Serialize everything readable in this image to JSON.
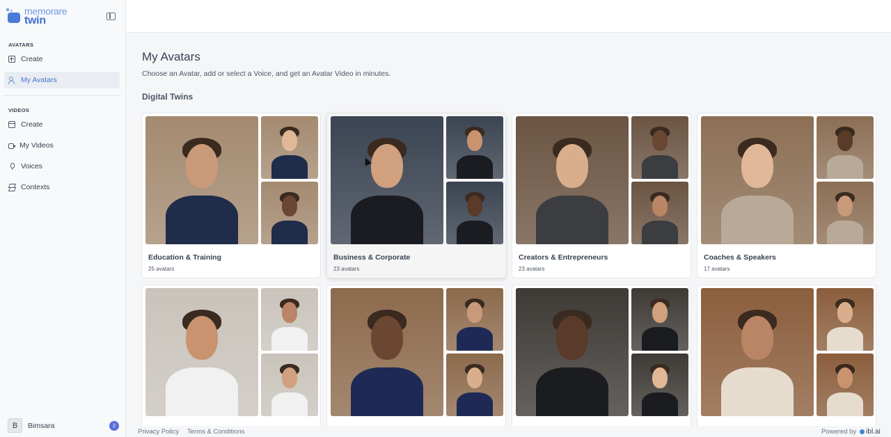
{
  "app": {
    "logo_line1": "memorare",
    "logo_line2": "twin"
  },
  "sidebar": {
    "avatars_section": "AVATARS",
    "avatars_items": [
      {
        "label": "Create",
        "icon": "plus-square-icon"
      },
      {
        "label": "My Avatars",
        "icon": "users-icon",
        "active": true
      }
    ],
    "videos_section": "VIDEOS",
    "videos_items": [
      {
        "label": "Create",
        "icon": "film-icon"
      },
      {
        "label": "My Videos",
        "icon": "video-icon"
      },
      {
        "label": "Voices",
        "icon": "mic-icon"
      },
      {
        "label": "Contexts",
        "icon": "layers-icon"
      }
    ],
    "user": {
      "initial": "B",
      "name": "Bimsara",
      "notifications": "2"
    }
  },
  "main": {
    "title": "My Avatars",
    "subtitle": "Choose an Avatar, add or select a Voice, and get an Avatar Video in minutes.",
    "section": "Digital Twins",
    "cards": [
      {
        "title": "Education & Training",
        "count": "25 avatars",
        "bg": "#a48a70",
        "accent": "#1f2c4a"
      },
      {
        "title": "Business & Corporate",
        "count": "23 avatars",
        "bg": "#3b4452",
        "accent": "#1a1c22"
      },
      {
        "title": "Creators & Entrepreneurs",
        "count": "23 avatars",
        "bg": "#6b5442",
        "accent": "#3b3d40"
      },
      {
        "title": "Coaches & Speakers",
        "count": "17 avatars",
        "bg": "#8c6f55",
        "accent": "#b9a999"
      },
      {
        "title": "",
        "count": "",
        "bg": "#c9c3bb",
        "accent": "#f1f1f1"
      },
      {
        "title": "",
        "count": "",
        "bg": "#8c6a4c",
        "accent": "#1e2a55"
      },
      {
        "title": "",
        "count": "",
        "bg": "#3e3a36",
        "accent": "#1b1c20"
      },
      {
        "title": "",
        "count": "",
        "bg": "#8b5e3c",
        "accent": "#e6dccd"
      }
    ]
  },
  "footer": {
    "privacy": "Privacy Policy",
    "terms": "Terms & Conditions",
    "powered_by": "Powered by",
    "brand": "ibl.ai"
  }
}
